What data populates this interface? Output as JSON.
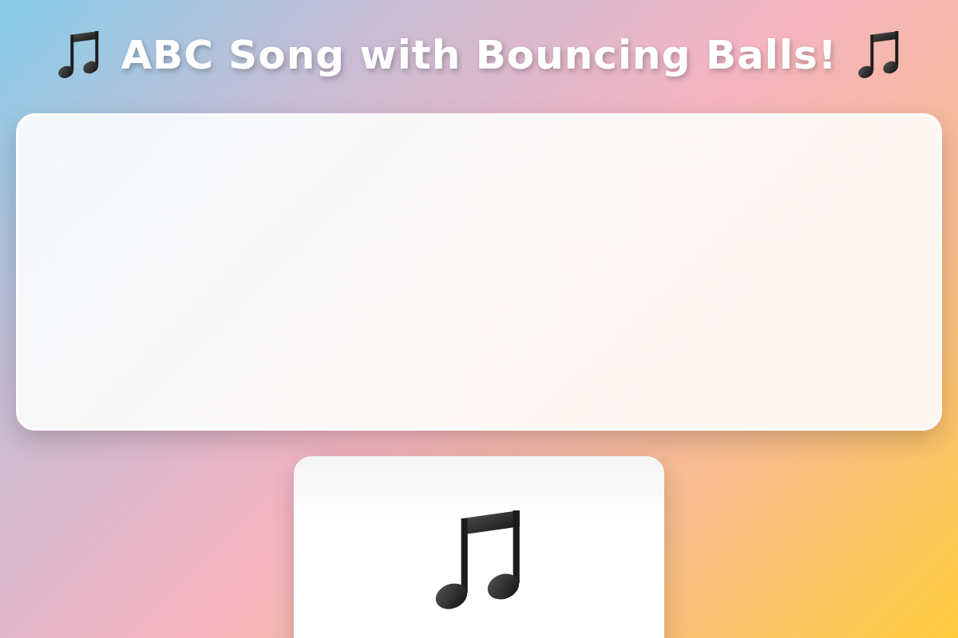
{
  "title": "ABC Song with Bouncing Balls!"
}
